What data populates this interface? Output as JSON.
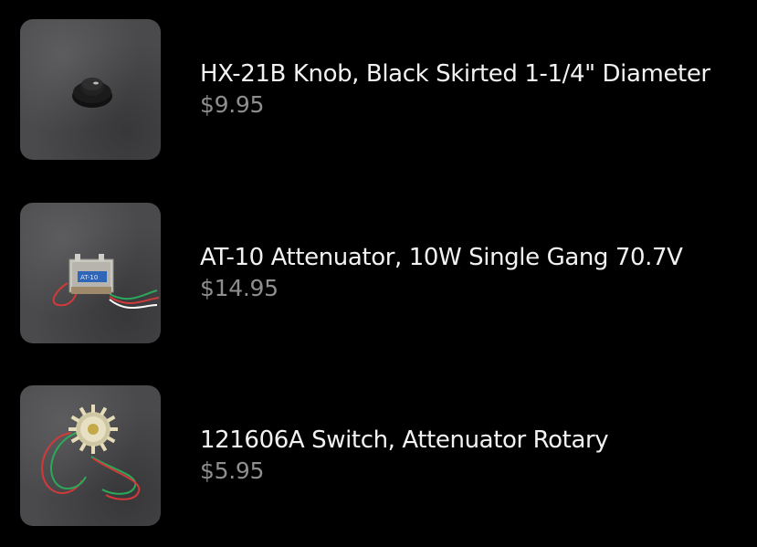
{
  "products": [
    {
      "title": "HX-21B Knob, Black Skirted 1-1/4\" Diameter",
      "price": "$9.95",
      "image_icon": "knob-icon"
    },
    {
      "title": "AT-10 Attenuator, 10W Single Gang 70.7V",
      "price": "$14.95",
      "image_icon": "attenuator-icon"
    },
    {
      "title": "121606A Switch, Attenuator Rotary",
      "price": "$5.95",
      "image_icon": "rotary-switch-icon"
    }
  ],
  "colors": {
    "background": "#000000",
    "title": "#f2f2f2",
    "price": "#8e8e8e",
    "thumbnail": "#4a4a4d"
  }
}
